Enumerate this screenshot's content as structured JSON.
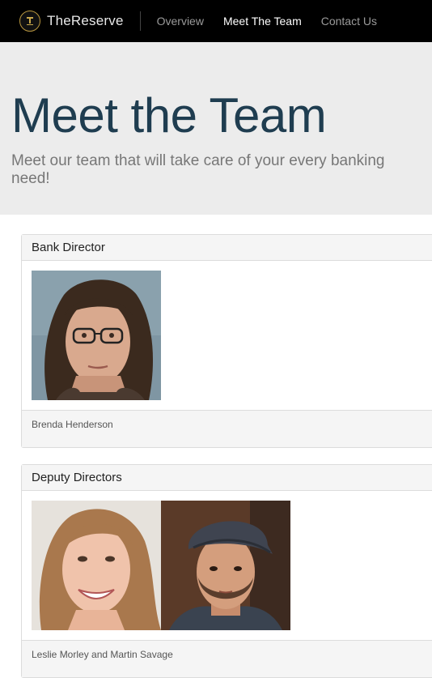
{
  "navbar": {
    "brand": "TheReserve",
    "links": [
      "Overview",
      "Meet The Team",
      "Contact Us"
    ],
    "active_index": 1
  },
  "jumbotron": {
    "title": "Meet the Team",
    "subtitle": "Meet our team that will take care of your every banking need!"
  },
  "panels": [
    {
      "heading": "Bank Director",
      "footer": "Brenda Henderson"
    },
    {
      "heading": "Deputy Directors",
      "footer": "Leslie Morley and Martin Savage"
    }
  ],
  "colors": {
    "navbar_bg": "#000000",
    "title": "#1f3d50",
    "jumbotron_bg": "#ececec",
    "brand_gold": "#b9973f"
  }
}
